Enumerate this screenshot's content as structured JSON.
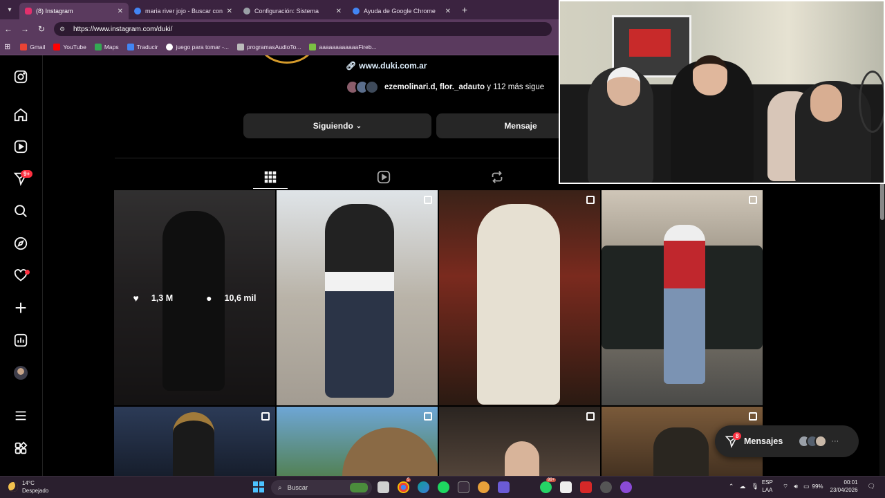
{
  "browser": {
    "tabs": [
      {
        "label": "(8) Instagram",
        "icon_color": "#e1306c",
        "active": true
      },
      {
        "label": "maria river jojo - Buscar con Go",
        "icon_color": "#4285f4",
        "active": false
      },
      {
        "label": "Configuración: Sistema",
        "icon_color": "#9aa0a6",
        "active": false
      },
      {
        "label": "Ayuda de Google Chrome",
        "icon_color": "#4285f4",
        "active": false
      }
    ],
    "new_tab": "+",
    "url": "https://www.instagram.com/duki/",
    "bookmarks": [
      {
        "label": "Gmail",
        "color": "#ea4335"
      },
      {
        "label": "YouTube",
        "color": "#ff0000"
      },
      {
        "label": "Maps",
        "color": "#34a853"
      },
      {
        "label": "Traducir",
        "color": "#4285f4"
      },
      {
        "label": "juego para tomar -...",
        "color": "#ffffff"
      },
      {
        "label": "programasAudioTo...",
        "color": "#bbbbbb"
      },
      {
        "label": "aaaaaaaaaaaaFireb...",
        "color": "#7bc043"
      }
    ]
  },
  "sidebar": {
    "notifications_badge": "9+",
    "icons": [
      "instagram-icon",
      "home-icon",
      "reels-icon",
      "messages-icon",
      "search-icon",
      "explore-icon",
      "notifications-icon",
      "create-icon",
      "dashboard-icon",
      "profile-icon",
      "menu-icon",
      "meta-apps-icon"
    ]
  },
  "profile": {
    "website": "www.duki.com.ar",
    "followed_by_names": "ezemolinari.d, flor._adauto",
    "followed_by_more": " y 112 más sigue",
    "following_button": "Siguiendo",
    "following_chevron": "⌄",
    "message_button": "Mensaje"
  },
  "posts_overlay": {
    "likes": "1,3 M",
    "comments": "10,6 mil"
  },
  "messages_pill": {
    "label": "Mensajes",
    "badge": "8",
    "more": "···"
  },
  "taskbar": {
    "temperature": "14°C",
    "weather": "Despejado",
    "search_placeholder": "Buscar",
    "lang_top": "ESP",
    "lang_bottom": "LAA",
    "battery": "99%",
    "time": "00:01",
    "date": "23/04/2026",
    "badge_a": "5",
    "badge_b": "99+"
  }
}
